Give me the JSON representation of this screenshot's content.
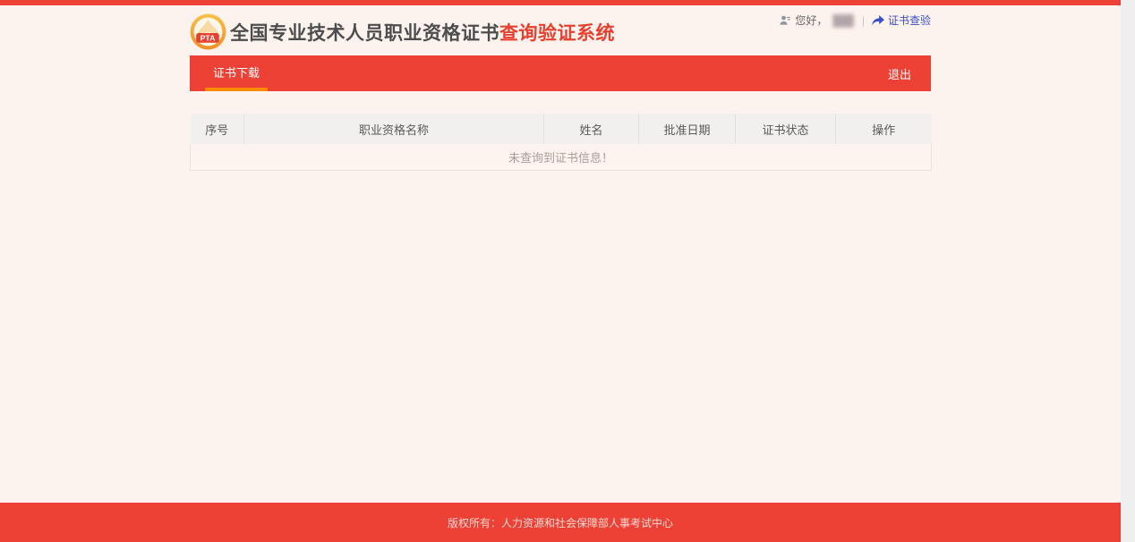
{
  "colors": {
    "accent_red": "#ee4136",
    "tab_underline_orange": "#ff8b00",
    "link_blue": "#3a50c4",
    "page_background": "#fdf3ee"
  },
  "header": {
    "logo_text": "PTA",
    "title_main": "全国专业技术人员职业资格证书",
    "title_accent": "查询验证系统",
    "greeting": "您好，",
    "user_name_masked": "███",
    "divider": "|",
    "verify_link_label": "证书查验"
  },
  "nav": {
    "active_tab_label": "证书下载",
    "logout_label": "退出"
  },
  "table": {
    "columns": [
      "序号",
      "职业资格名称",
      "姓名",
      "批准日期",
      "证书状态",
      "操作"
    ],
    "empty_message": "未查询到证书信息！"
  },
  "footer": {
    "copyright": "版权所有：人力资源和社会保障部人事考试中心"
  }
}
